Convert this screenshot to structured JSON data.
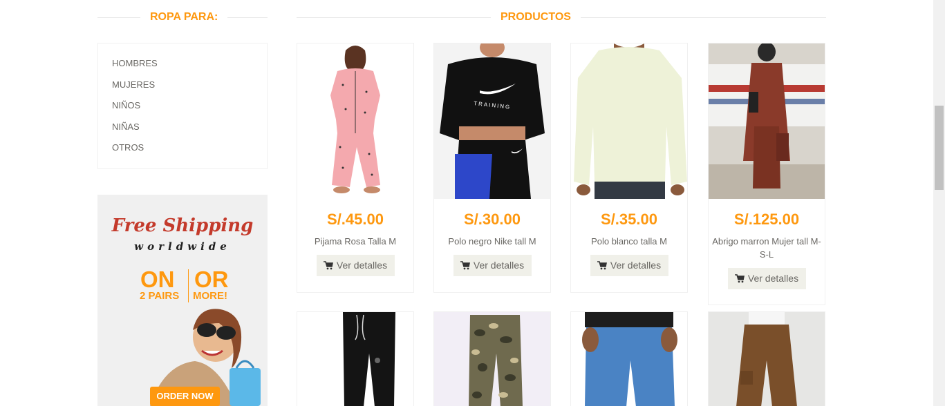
{
  "sidebar": {
    "title": "ROPA PARA:",
    "categories": [
      "HOMBRES",
      "MUJERES",
      "NIÑOS",
      "NIÑAS",
      "OTROS"
    ]
  },
  "banner": {
    "free_shipping": "Free Shipping",
    "worldwide": "worldwide",
    "on": "ON",
    "or": "OR",
    "pairs": "2 PAIRS",
    "more": "MORE!",
    "order_now": "ORDER NOW"
  },
  "products_title": "PRODUCTOS",
  "products": [
    {
      "price": "S/.45.00",
      "name": "Pijama Rosa Talla M",
      "button": "Ver detalles"
    },
    {
      "price": "S/.30.00",
      "name": "Polo negro Nike tall M",
      "button": "Ver detalles"
    },
    {
      "price": "S/.35.00",
      "name": "Polo blanco talla M",
      "button": "Ver detalles"
    },
    {
      "price": "S/.125.00",
      "name": "Abrigo marron Mujer tall M-S-L",
      "button": "Ver detalles"
    }
  ],
  "colors": {
    "accent": "#fe980f",
    "button_bg": "#f0f0e9",
    "text": "#696763"
  }
}
